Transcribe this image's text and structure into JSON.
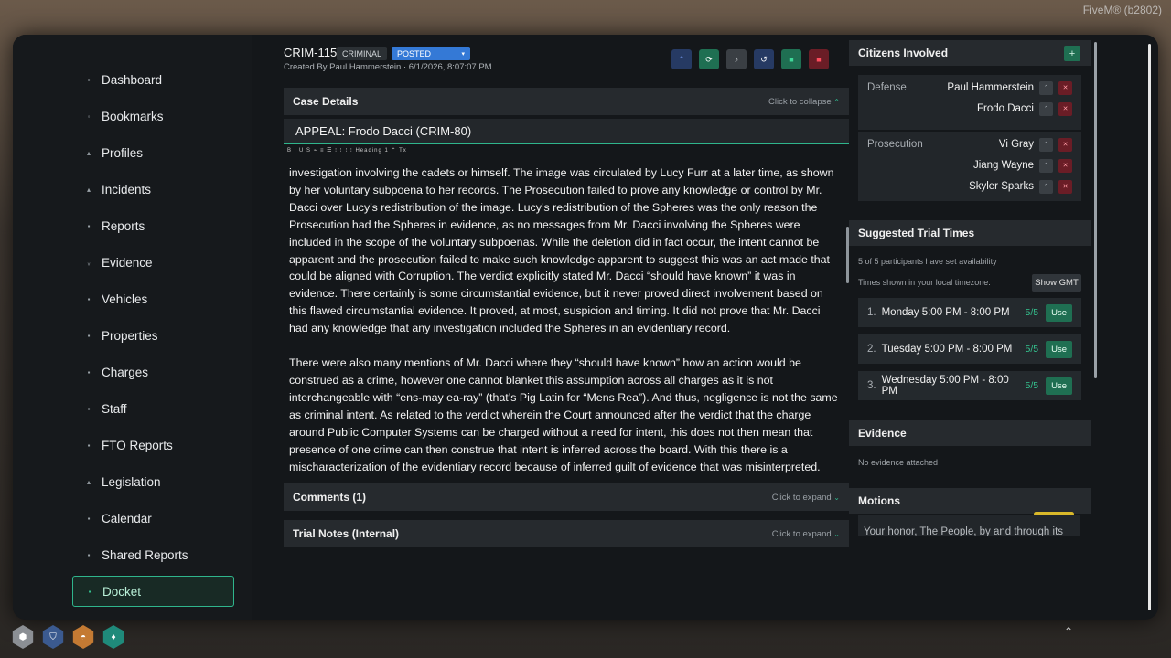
{
  "overlay": {
    "fivem_label": "FiveM® (b2802)"
  },
  "sidebar": {
    "items": [
      {
        "label": "Dashboard",
        "icon": "dashboard-icon",
        "glyph": "▪"
      },
      {
        "label": "Bookmarks",
        "icon": "bookmark-icon",
        "glyph": "◦"
      },
      {
        "label": "Profiles",
        "icon": "profile-icon",
        "glyph": "▴"
      },
      {
        "label": "Incidents",
        "icon": "incident-icon",
        "glyph": "▴"
      },
      {
        "label": "Reports",
        "icon": "report-icon",
        "glyph": "▪"
      },
      {
        "label": "Evidence",
        "icon": "evidence-icon",
        "glyph": "ᵥ"
      },
      {
        "label": "Vehicles",
        "icon": "vehicle-icon",
        "glyph": "▪"
      },
      {
        "label": "Properties",
        "icon": "property-icon",
        "glyph": "▪"
      },
      {
        "label": "Charges",
        "icon": "charge-icon",
        "glyph": "▪"
      },
      {
        "label": "Staff",
        "icon": "staff-icon",
        "glyph": "▪"
      },
      {
        "label": "FTO Reports",
        "icon": "fto-icon",
        "glyph": "▪"
      },
      {
        "label": "Legislation",
        "icon": "legislation-icon",
        "glyph": "▴"
      },
      {
        "label": "Calendar",
        "icon": "calendar-icon",
        "glyph": "▪"
      },
      {
        "label": "Shared Reports",
        "icon": "shared-icon",
        "glyph": "▪"
      },
      {
        "label": "Docket",
        "icon": "docket-icon",
        "glyph": "▪",
        "active": true
      }
    ]
  },
  "header": {
    "case_id": "CRIM-115",
    "type_tag": "CRIMINAL",
    "status": "POSTED",
    "status_caret": "▾",
    "created_by": "Created By Paul Hammerstein · 6/1/2026, 8:07:07 PM",
    "toolbar_buttons": [
      {
        "name": "collapse-icon",
        "glyph": "⌃",
        "bg": "#263a63",
        "fg": "#6b8fe0"
      },
      {
        "name": "refresh-icon",
        "glyph": "⟳",
        "bg": "#1f6f52",
        "fg": "#ffffff"
      },
      {
        "name": "bell-icon",
        "glyph": "♪",
        "bg": "#3a3f44",
        "fg": "#c8ccd0"
      },
      {
        "name": "history-icon",
        "glyph": "↺",
        "bg": "#263a63",
        "fg": "#ffffff"
      },
      {
        "name": "stop-icon",
        "glyph": "■",
        "bg": "#1f6f52",
        "fg": "#3fd99a"
      },
      {
        "name": "delete-icon",
        "glyph": "■",
        "bg": "#6a1d26",
        "fg": "#ff4d5e"
      }
    ]
  },
  "case_details": {
    "header": "Case Details",
    "hint": "Click to collapse",
    "hint_caret": "⌃",
    "title": "APPEAL: Frodo Dacci (CRIM-80)",
    "toolbar": "B I U S ⌁ ≡ ☰ ⁝ ⁝ ⁝ ⁝ Heading 1 ⌃ Tx",
    "paragraphs": [
      "investigation involving the cadets or himself. The image was circulated by Lucy Furr at a later time, as shown by her voluntary subpoena to her records. The Prosecution failed to prove any knowledge or control by Mr. Dacci over Lucy’s redistribution of the image. Lucy’s redistribution of the Spheres was the only reason the Prosecution had the Spheres in evidence, as no messages from Mr. Dacci involving the Spheres were included in the scope of the voluntary subpoenas. While the deletion did in fact occur, the intent cannot be apparent and the prosecution failed to make such knowledge apparent to suggest this was an act made that could be aligned with Corruption. The verdict explicitly stated Mr. Dacci “should have known” it was in evidence. There certainly is some circumstantial evidence, but it never proved direct involvement based on this flawed circumstantial evidence. It proved, at most, suspicion and timing. It did not prove that Mr. Dacci had any knowledge that any investigation included the Spheres in an evidentiary record.",
      "There were also many mentions of Mr. Dacci where they “should have known” how an action would be construed as a crime, however one cannot blanket this assumption across all charges as it is not interchangeable with “ens-may ea-ray” (that’s Pig Latin for “Mens Rea”). And thus, negligence is not the same as criminal intent. As related to the verdict wherein the Court announced after the verdict that the charge around Public Computer Systems can be charged without a need for intent, this does not then mean that presence of one crime can then construe that intent is inferred across the board. With this there is a  mischaracterization of the evidentiary record because of inferred guilt of evidence that was misinterpreted. The Court verdict made mention of “clandestine meetings” however the"
    ]
  },
  "comments": {
    "header": "Comments (1)",
    "hint": "Click to expand",
    "caret": "⌄"
  },
  "trial_notes": {
    "header": "Trial Notes (Internal)",
    "hint": "Click to expand",
    "caret": "⌄"
  },
  "citizens": {
    "header": "Citizens Involved",
    "add": "+",
    "up_glyph": "⌃",
    "remove_glyph": "✕",
    "defense": {
      "label": "Defense",
      "names": [
        "Paul Hammerstein",
        "Frodo Dacci"
      ]
    },
    "prosecution": {
      "label": "Prosecution",
      "names": [
        "Vi Gray",
        "Jiang Wayne",
        "Skyler Sparks"
      ]
    }
  },
  "trial_times": {
    "header": "Suggested Trial Times",
    "availability": "5 of 5 participants have set availability",
    "timezone_note": "Times shown in your local timezone.",
    "show_gmt": "Show GMT",
    "slots": [
      {
        "idx": "1.",
        "label": "Monday 5:00 PM - 8:00 PM",
        "ratio": "5/5",
        "use": "Use"
      },
      {
        "idx": "2.",
        "label": "Tuesday 5:00 PM - 8:00 PM",
        "ratio": "5/5",
        "use": "Use"
      },
      {
        "idx": "3.",
        "label": "Wednesday 5:00 PM - 8:00 PM",
        "ratio": "5/5",
        "use": "Use"
      }
    ]
  },
  "evidence": {
    "header": "Evidence",
    "empty": "No evidence attached"
  },
  "motions": {
    "header": "Motions",
    "preview": "Your honor, The People, by and through its"
  },
  "dock": {
    "icons": [
      {
        "name": "settings-hex-icon",
        "color": "#8b8f94",
        "glyph": "⬢"
      },
      {
        "name": "shield-hex-icon",
        "color": "#3b5a8f",
        "glyph": "⛉"
      },
      {
        "name": "food-hex-icon",
        "color": "#c47a33",
        "glyph": "◓"
      },
      {
        "name": "water-hex-icon",
        "color": "#1f8a7a",
        "glyph": "♦"
      }
    ],
    "chevron": "⌃"
  }
}
